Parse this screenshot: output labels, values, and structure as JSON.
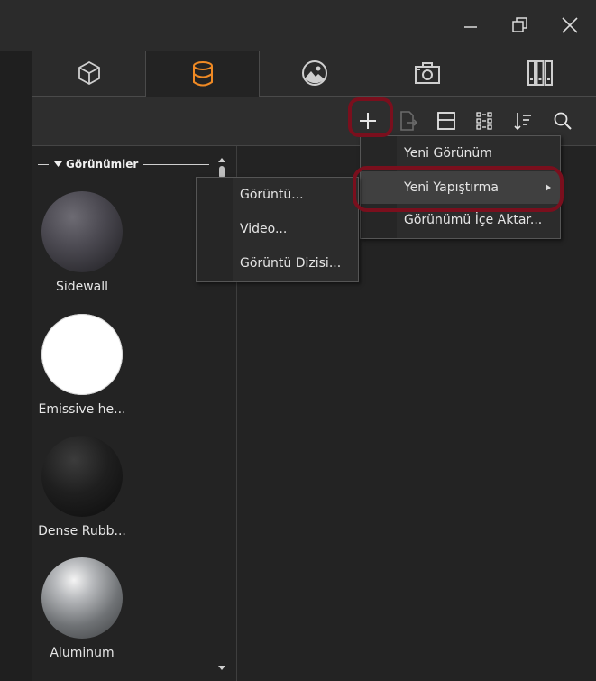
{
  "window": {
    "minimize_icon": "minimize-icon",
    "restore_icon": "restore-icon",
    "close_icon": "close-icon"
  },
  "tabs": [
    {
      "icon": "cube-icon",
      "active": false
    },
    {
      "icon": "database-icon",
      "active": true
    },
    {
      "icon": "image-icon",
      "active": false
    },
    {
      "icon": "camera-icon",
      "active": false
    },
    {
      "icon": "library-icon",
      "active": false
    }
  ],
  "toolbar": {
    "icons": [
      "add-icon",
      "export-icon",
      "layout-icon",
      "grid-view-icon",
      "sort-icon",
      "search-icon"
    ]
  },
  "sidebar": {
    "section_title": "Görünümler",
    "items": [
      {
        "label": "Sidewall",
        "material": "dark-gray-rough"
      },
      {
        "label": "Emissive he...",
        "material": "white"
      },
      {
        "label": "Dense Rubb...",
        "material": "black-rubber"
      },
      {
        "label": "Aluminum",
        "material": "aluminum"
      }
    ]
  },
  "add_menu": {
    "items": [
      {
        "label": "Yeni Görünüm"
      },
      {
        "label": "Yeni Yapıştırma",
        "has_submenu": true
      },
      {
        "label": "Görünümü İçe Aktar..."
      }
    ]
  },
  "submenu": {
    "items": [
      {
        "label": "Görüntü..."
      },
      {
        "label": "Video..."
      },
      {
        "label": "Görüntü Dizisi..."
      }
    ]
  },
  "colors": {
    "accent": "#f08a24",
    "highlight_ring": "#7a0f1d",
    "background": "#232323"
  }
}
